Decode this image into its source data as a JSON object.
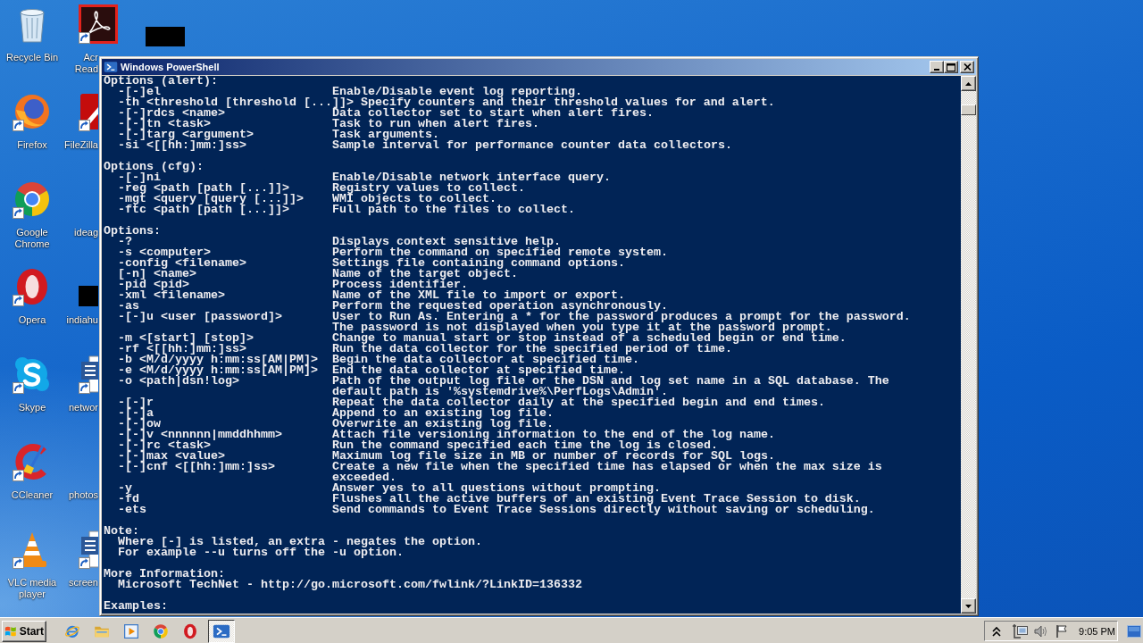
{
  "desktop": {
    "columns": [
      {
        "icons": [
          {
            "kind": "recycle-bin",
            "label_lines": [
              "Recycle Bin"
            ],
            "shortcut": false
          },
          {
            "kind": "firefox",
            "label_lines": [
              "Firefox"
            ],
            "shortcut": true
          },
          {
            "kind": "chrome",
            "label_lines": [
              "Google",
              "Chrome"
            ],
            "shortcut": true
          },
          {
            "kind": "opera",
            "label_lines": [
              "Opera"
            ],
            "shortcut": true
          },
          {
            "kind": "skype",
            "label_lines": [
              "Skype"
            ],
            "shortcut": true
          },
          {
            "kind": "ccleaner",
            "label_lines": [
              "CCleaner"
            ],
            "shortcut": true
          },
          {
            "kind": "vlc",
            "label_lines": [
              "VLC media",
              "player"
            ],
            "shortcut": true
          }
        ]
      },
      {
        "icons": [
          {
            "kind": "acrobat",
            "label_lines": [
              "Acr",
              "Read"
            ],
            "shortcut": true
          },
          {
            "kind": "filezilla",
            "label_lines": [
              "FileZilla"
            ],
            "shortcut": true
          },
          {
            "kind": "blank",
            "label_lines": [
              "ideag"
            ]
          },
          {
            "kind": "redacted",
            "label_lines": [
              "indiahu"
            ]
          },
          {
            "kind": "word-document",
            "label_lines": [
              "networ"
            ],
            "shortcut": true
          },
          {
            "kind": "blank",
            "label_lines": [
              "photos"
            ]
          },
          {
            "kind": "word-document",
            "label_lines": [
              "screen"
            ],
            "shortcut": true
          }
        ]
      },
      {
        "icons": [
          {
            "kind": "redacted"
          }
        ]
      }
    ]
  },
  "window": {
    "title": "Windows PowerShell",
    "console": {
      "sections": [
        {
          "kind": "options",
          "heading": "Options (alert):",
          "rows": [
            {
              "flag": "-[-]el",
              "description": [
                "Enable/Disable event log reporting."
              ]
            },
            {
              "flag": "-th <threshold [threshold [...]]>",
              "description": [
                "Specify counters and their threshold values for and alert."
              ]
            },
            {
              "flag": "-[-]rdcs <name>",
              "description": [
                "Data collector set to start when alert fires."
              ]
            },
            {
              "flag": "-[-]tn <task>",
              "description": [
                "Task to run when alert fires."
              ]
            },
            {
              "flag": "-[-]targ <argument>",
              "description": [
                "Task arguments."
              ]
            },
            {
              "flag": "-si <[[hh:]mm:]ss>",
              "description": [
                "Sample interval for performance counter data collectors."
              ]
            }
          ]
        },
        {
          "kind": "options",
          "heading": "Options (cfg):",
          "rows": [
            {
              "flag": "-[-]ni",
              "description": [
                "Enable/Disable network interface query."
              ]
            },
            {
              "flag": "-reg <path [path [...]]>",
              "description": [
                "Registry values to collect."
              ]
            },
            {
              "flag": "-mgt <query [query [...]]>",
              "description": [
                "WMI objects to collect."
              ]
            },
            {
              "flag": "-ftc <path [path [...]]>",
              "description": [
                "Full path to the files to collect."
              ]
            }
          ]
        },
        {
          "kind": "options",
          "heading": "Options:",
          "rows": [
            {
              "flag": "-?",
              "description": [
                "Displays context sensitive help."
              ]
            },
            {
              "flag": "-s <computer>",
              "description": [
                "Perform the command on specified remote system."
              ]
            },
            {
              "flag": "-config <filename>",
              "description": [
                "Settings file containing command options."
              ]
            },
            {
              "flag": "[-n] <name>",
              "description": [
                "Name of the target object."
              ]
            },
            {
              "flag": "-pid <pid>",
              "description": [
                "Process identifier."
              ]
            },
            {
              "flag": "-xml <filename>",
              "description": [
                "Name of the XML file to import or export."
              ]
            },
            {
              "flag": "-as",
              "description": [
                "Perform the requested operation asynchronously."
              ]
            },
            {
              "flag": "-[-]u <user [password]>",
              "description": [
                "User to Run As. Entering a * for the password produces a prompt for the password.",
                "The password is not displayed when you type it at the password prompt."
              ]
            },
            {
              "flag": "-m <[start] [stop]>",
              "description": [
                "Change to manual start or stop instead of a scheduled begin or end time."
              ]
            },
            {
              "flag": "-rf <[[hh:]mm:]ss>",
              "description": [
                "Run the data collector for the specified period of time."
              ]
            },
            {
              "flag": "-b <M/d/yyyy h:mm:ss[AM|PM]>",
              "description": [
                "Begin the data collector at specified time."
              ]
            },
            {
              "flag": "-e <M/d/yyyy h:mm:ss[AM|PM]>",
              "description": [
                "End the data collector at specified time."
              ]
            },
            {
              "flag": "-o <path|dsn!log>",
              "description": [
                "Path of the output log file or the DSN and log set name in a SQL database. The",
                "default path is '%systemdrive%\\PerfLogs\\Admin'."
              ]
            },
            {
              "flag": "-[-]r",
              "description": [
                "Repeat the data collector daily at the specified begin and end times."
              ]
            },
            {
              "flag": "-[-]a",
              "description": [
                "Append to an existing log file."
              ]
            },
            {
              "flag": "-[-]ow",
              "description": [
                "Overwrite an existing log file."
              ]
            },
            {
              "flag": "-[-]v <nnnnnn|mmddhhmm>",
              "description": [
                "Attach file versioning information to the end of the log name."
              ]
            },
            {
              "flag": "-[-]rc <task>",
              "description": [
                "Run the command specified each time the log is closed."
              ]
            },
            {
              "flag": "-[-]max <value>",
              "description": [
                "Maximum log file size in MB or number of records for SQL logs."
              ]
            },
            {
              "flag": "-[-]cnf <[[hh:]mm:]ss>",
              "description": [
                "Create a new file when the specified time has elapsed or when the max size is",
                "exceeded."
              ]
            },
            {
              "flag": "-y",
              "description": [
                "Answer yes to all questions without prompting."
              ]
            },
            {
              "flag": "-fd",
              "description": [
                "Flushes all the active buffers of an existing Event Trace Session to disk."
              ]
            },
            {
              "flag": "-ets",
              "description": [
                "Send commands to Event Trace Sessions directly without saving or scheduling."
              ]
            }
          ]
        },
        {
          "kind": "text",
          "heading": "Note:",
          "lines": [
            "Where [-] is listed, an extra - negates the option.",
            "For example --u turns off the -u option."
          ]
        },
        {
          "kind": "text",
          "heading": "More Information:",
          "lines": [
            "Microsoft TechNet - http://go.microsoft.com/fwlink/?LinkID=136332"
          ]
        },
        {
          "kind": "text",
          "heading": "Examples:"
        }
      ]
    }
  },
  "taskbar": {
    "start_label": "Start",
    "quick_launch": [
      {
        "kind": "ie"
      },
      {
        "kind": "folder"
      },
      {
        "kind": "media-player"
      },
      {
        "kind": "chrome"
      },
      {
        "kind": "opera"
      }
    ],
    "tasks": [
      {
        "kind": "powershell",
        "selected": true
      }
    ],
    "tray": {
      "icons": [
        {
          "kind": "chevron"
        },
        {
          "kind": "network"
        },
        {
          "kind": "volume"
        },
        {
          "kind": "flag"
        }
      ],
      "clock": "9:05 PM"
    }
  }
}
